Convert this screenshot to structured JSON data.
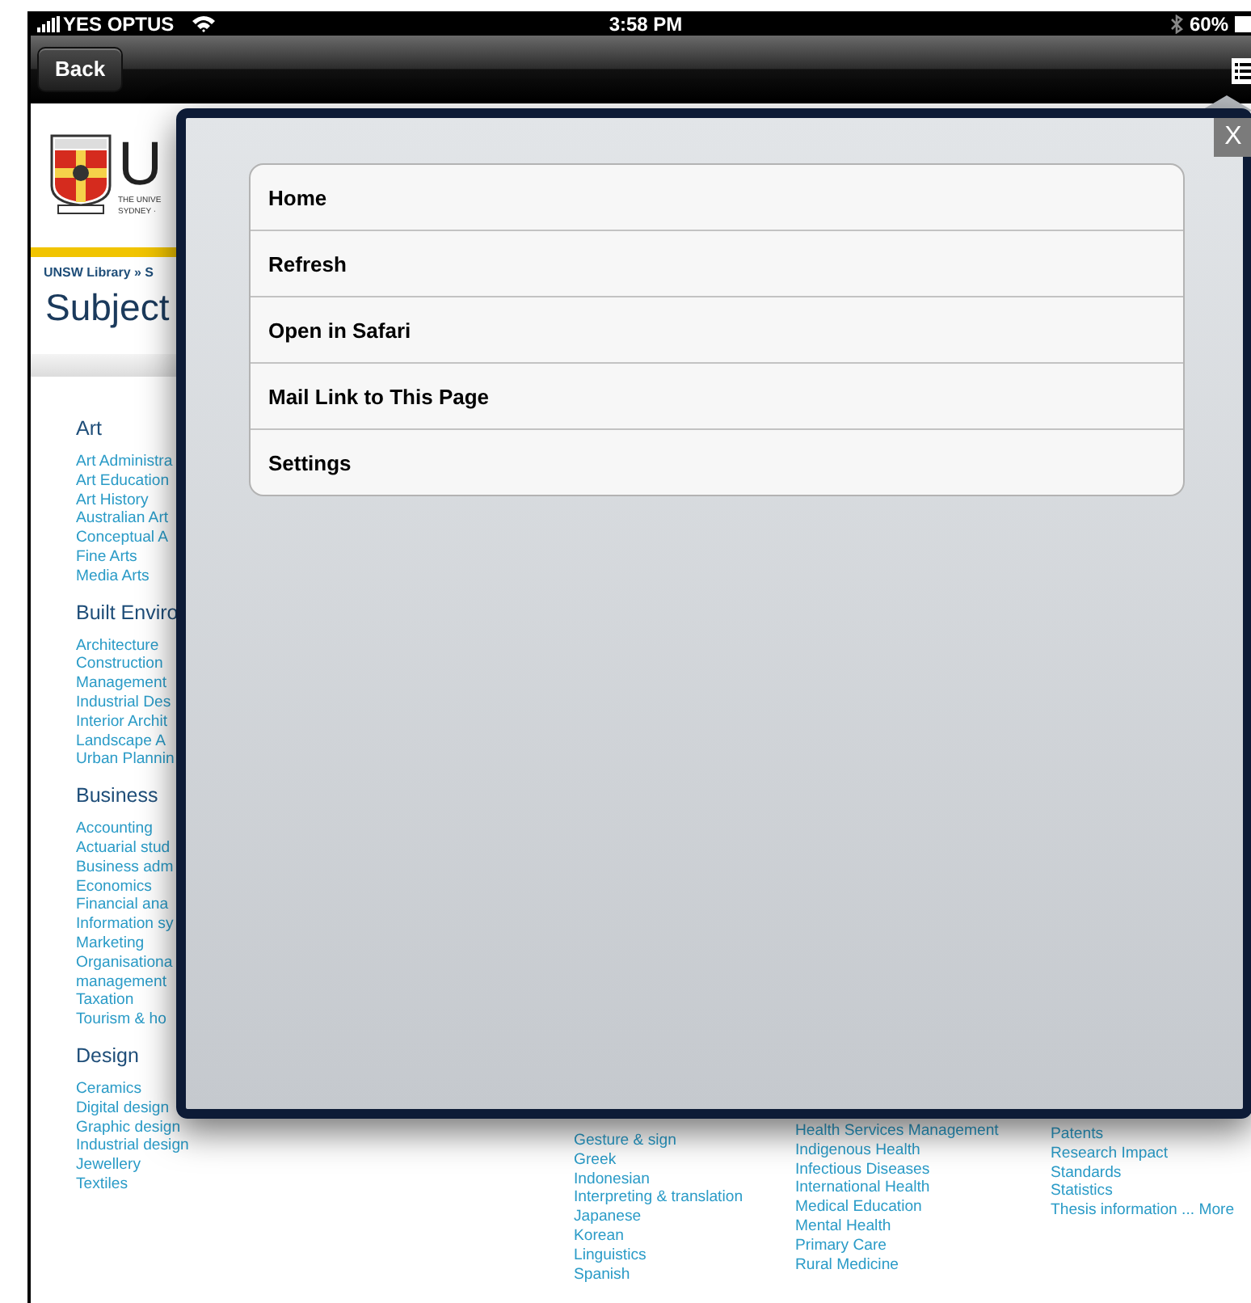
{
  "status_bar": {
    "carrier": "YES OPTUS",
    "time": "3:58 PM",
    "battery": "60%"
  },
  "nav_bar": {
    "back_button": "Back"
  },
  "page": {
    "logo": {
      "letters": "U",
      "lines": [
        "THE UNIVE",
        "SYDNEY ·"
      ]
    },
    "breadcrumb": "UNSW Library » S",
    "title": "Subject",
    "sections": [
      {
        "heading": "Art",
        "links": [
          "Art Administra",
          "Art Education",
          "Art History",
          "Australian Art",
          "Conceptual A",
          "Fine Arts",
          "Media Arts"
        ]
      },
      {
        "heading": "Built Enviro",
        "links": [
          "Architecture",
          "Construction",
          "Management",
          "Industrial Des",
          "Interior Archit",
          "Landscape A",
          "Urban Plannin"
        ]
      },
      {
        "heading": "Business",
        "links": [
          "Accounting",
          "Actuarial stud",
          "Business adm",
          "Economics",
          "Financial ana",
          "Information sy",
          "Marketing",
          "Organisationa",
          "management",
          "Taxation",
          "Tourism & ho"
        ]
      },
      {
        "heading": "Design",
        "links": [
          "Ceramics",
          "Digital design",
          "Graphic design",
          "Industrial design",
          "Jewellery",
          "Textiles"
        ]
      }
    ],
    "columns": [
      [
        "Gesture & sign",
        "Greek",
        "Indonesian",
        "Interpreting & translation",
        "Japanese",
        "Korean",
        "Linguistics",
        "Spanish"
      ],
      [
        "Health Services Management",
        "Indigenous Health",
        "Infectious Diseases",
        "International Health",
        "Medical Education",
        "Mental Health",
        "Primary Care",
        "Rural Medicine"
      ],
      [
        "Patents",
        "Research Impact",
        "Standards",
        "Statistics",
        "Thesis information ... More"
      ]
    ]
  },
  "menu": {
    "close": "X",
    "items": [
      {
        "label": "Home"
      },
      {
        "label": "Refresh"
      },
      {
        "label": "Open in Safari"
      },
      {
        "label": "Mail Link to This Page"
      },
      {
        "label": "Settings"
      }
    ]
  }
}
